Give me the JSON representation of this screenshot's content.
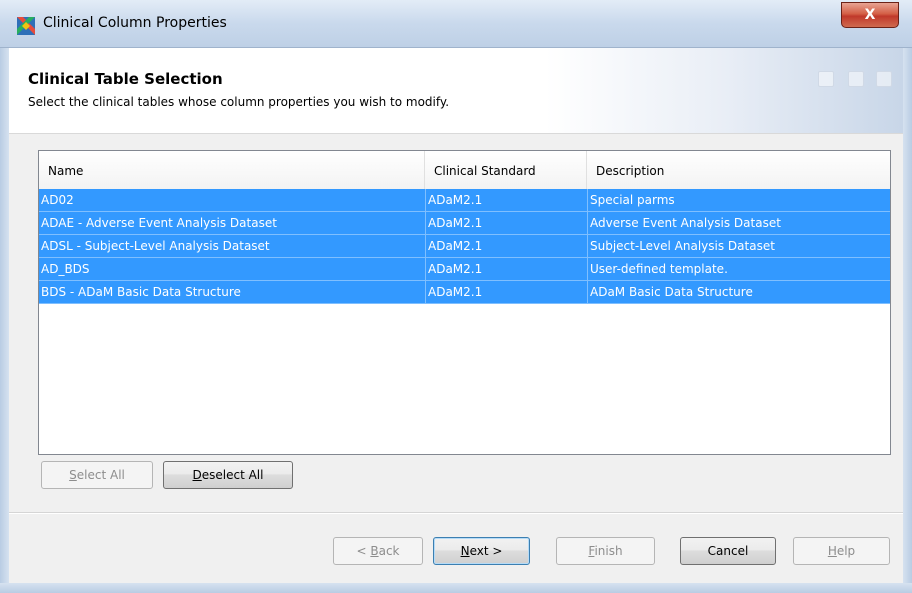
{
  "window": {
    "title": "Clinical Column Properties",
    "close_label": "X"
  },
  "header": {
    "title": "Clinical Table Selection",
    "subtitle": "Select the clinical tables whose column properties you wish to modify."
  },
  "table": {
    "columns": [
      "Name",
      "Clinical Standard",
      "Description"
    ],
    "rows": [
      {
        "name": "AD02",
        "standard": "ADaM2.1",
        "description": "Special parms"
      },
      {
        "name": "ADAE - Adverse Event Analysis Dataset",
        "standard": "ADaM2.1",
        "description": "Adverse Event Analysis Dataset"
      },
      {
        "name": "ADSL - Subject-Level Analysis Dataset",
        "standard": "ADaM2.1",
        "description": "Subject-Level Analysis Dataset"
      },
      {
        "name": "AD_BDS",
        "standard": "ADaM2.1",
        "description": "User-defined template."
      },
      {
        "name": "BDS - ADaM Basic Data Structure",
        "standard": "ADaM2.1",
        "description": "ADaM Basic Data Structure"
      }
    ]
  },
  "selection_buttons": {
    "select_all": {
      "first": "S",
      "rest": "elect All"
    },
    "deselect_all": {
      "first": "D",
      "rest": "eselect All"
    }
  },
  "nav_buttons": {
    "back": {
      "prefix": "< ",
      "first": "B",
      "rest": "ack"
    },
    "next": {
      "first": "N",
      "rest": "ext >"
    },
    "finish": {
      "first": "F",
      "rest": "inish"
    },
    "cancel": "Cancel",
    "help": {
      "first": "H",
      "rest": "elp"
    }
  },
  "colors": {
    "selection": "#3399ff",
    "titlebar": "#c9d9ec",
    "close": "#c0392b"
  }
}
